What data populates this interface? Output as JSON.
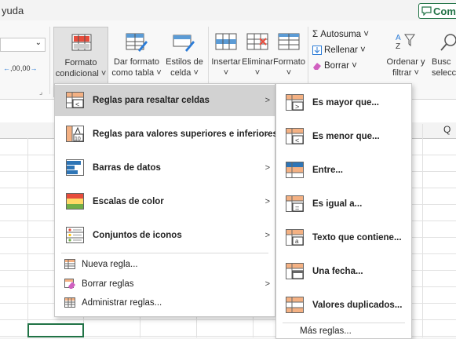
{
  "titlebar": {
    "menu_ayuda": "yuda",
    "comments_label": "Come"
  },
  "ribbon": {
    "number_dropdown_chevron": "⌄",
    "increase_decimals_label": ",00",
    "decrease_decimals_label": ",00",
    "formato_condicional": [
      "Formato",
      "condicional ˅"
    ],
    "dar_formato_tabla": [
      "Dar formato",
      "como tabla ˅"
    ],
    "estilos_celda": [
      "Estilos de",
      "celda ˅"
    ],
    "insertar": [
      "Insertar",
      "˅"
    ],
    "eliminar": [
      "Eliminar",
      "˅"
    ],
    "formato": [
      "Formato",
      "˅"
    ],
    "autosuma": "Σ Autosuma ˅",
    "rellenar": "Rellenar ˅",
    "borrar": "Borrar ˅",
    "ordenar_filtrar": [
      "Ordenar y",
      "filtrar ˅"
    ],
    "buscar": [
      "Busc",
      "selecci"
    ],
    "dialog_launcher_icon": "launcher-icon"
  },
  "sheet": {
    "col_q": "Q"
  },
  "menu_main": {
    "items": [
      {
        "label": "Reglas para resaltar celdas",
        "u": "R",
        "icon": "highlight-rules-icon",
        "submenu": true
      },
      {
        "label": "Reglas para valores superiores e inferiores",
        "u": "e",
        "icon": "top-bottom-rules-icon",
        "submenu": true
      },
      {
        "label": "Barras de datos",
        "u": "d",
        "icon": "data-bars-icon",
        "submenu": true
      },
      {
        "label": "Escalas de color",
        "u": "s",
        "icon": "color-scales-icon",
        "submenu": true
      },
      {
        "label": "Conjuntos de iconos",
        "u": "C",
        "icon": "icon-sets-icon",
        "submenu": true
      }
    ],
    "small_items": [
      {
        "label": "Nueva regla...",
        "icon": "new-rule-icon",
        "submenu": false
      },
      {
        "label": "Borrar reglas",
        "icon": "clear-rules-icon",
        "submenu": true
      },
      {
        "label": "Administrar reglas...",
        "icon": "manage-rules-icon",
        "submenu": false
      }
    ],
    "submenu_arrow": ">"
  },
  "menu_sub": {
    "items": [
      {
        "label": "Es mayor que...",
        "icon": "greater-than-icon"
      },
      {
        "label": "Es menor que...",
        "icon": "less-than-icon"
      },
      {
        "label": "Entre...",
        "icon": "between-icon"
      },
      {
        "label": "Es igual a...",
        "icon": "equal-to-icon"
      },
      {
        "label": "Texto que contiene...",
        "icon": "text-contains-icon"
      },
      {
        "label": "Una fecha...",
        "icon": "date-occurring-icon"
      },
      {
        "label": "Valores duplicados...",
        "icon": "duplicate-values-icon"
      }
    ],
    "more_rules": "Más reglas..."
  },
  "colors": {
    "accent_green": "#217346",
    "menu_hover": "#d2d2d2"
  }
}
